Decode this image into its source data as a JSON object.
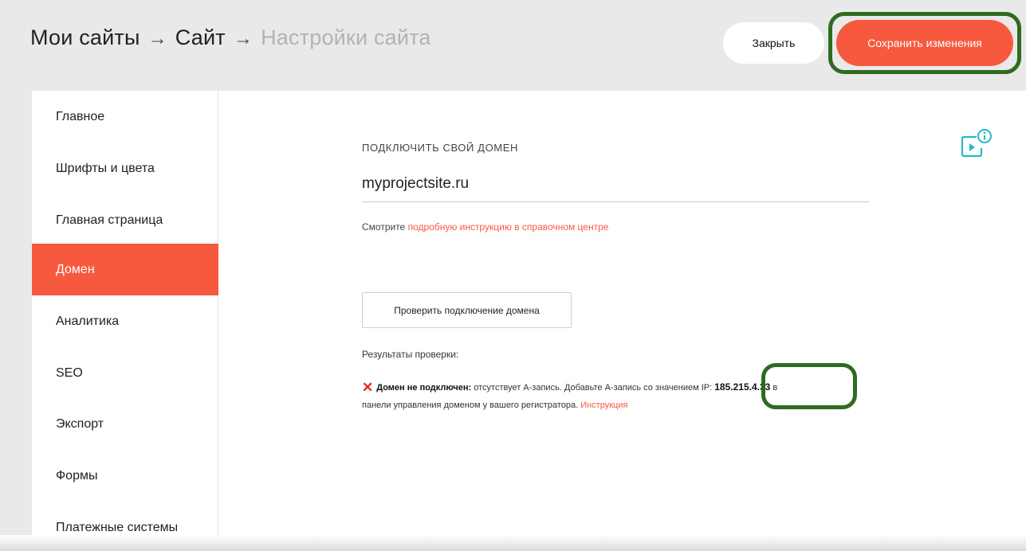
{
  "header": {
    "breadcrumb": [
      "Мои сайты",
      "Сайт",
      "Настройки сайта"
    ],
    "arrow": "→",
    "close_label": "Закрыть",
    "save_label": "Сохранить изменения"
  },
  "sidebar": {
    "items": [
      {
        "label": "Главное"
      },
      {
        "label": "Шрифты и цвета"
      },
      {
        "label": "Главная страница"
      },
      {
        "label": "Домен",
        "active": true
      },
      {
        "label": "Аналитика"
      },
      {
        "label": "SEO"
      },
      {
        "label": "Экспорт"
      },
      {
        "label": "Формы"
      },
      {
        "label": "Платежные системы"
      }
    ]
  },
  "domain": {
    "section_title": "ПОДКЛЮЧИТЬ СВОЙ ДОМЕН",
    "value": "myprojectsite.ru",
    "help_prefix": "Смотрите ",
    "help_link": "подробную инструкцию в справочном центре",
    "check_button": "Проверить подключение домена",
    "results_label": "Результаты проверки:",
    "result": {
      "status_icon": "✕",
      "status_bold": "Домен не подключен:",
      "text1": " отсутствует A-запись. Добавьте A-запись со значением IP: ",
      "ip": "185.215.4.33",
      "text2": " в",
      "text3": "панели управления доменом у вашего регистратора. ",
      "link": "Инструкция"
    }
  },
  "icons": {
    "video_help": "video-info-icon"
  },
  "colors": {
    "accent": "#f7593f",
    "highlight": "#2f6b1f",
    "error": "#e3242b",
    "teal": "#29b7c7"
  }
}
